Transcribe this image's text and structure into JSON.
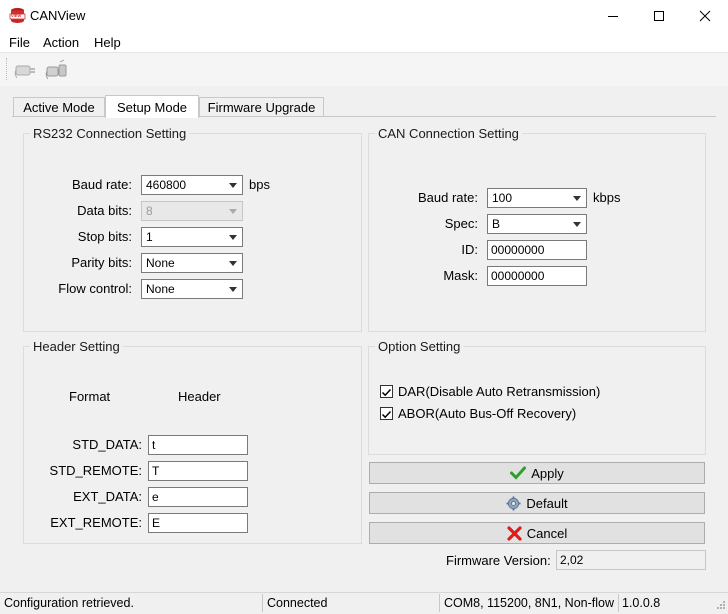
{
  "window": {
    "title": "CANView",
    "icon_text": "VIEW",
    "accent_color": "#d32f2f"
  },
  "menu": {
    "file": "File",
    "action": "Action",
    "help": "Help"
  },
  "toolbar": {
    "connect_icon": "connect-plug-icon",
    "disconnect_icon": "disconnect-plug-icon"
  },
  "tabs": [
    {
      "label": "Active Mode",
      "active": false
    },
    {
      "label": "Setup Mode",
      "active": true
    },
    {
      "label": "Firmware Upgrade",
      "active": false
    }
  ],
  "rs232": {
    "title": "RS232 Connection Setting",
    "baud_label": "Baud rate:",
    "baud_value": "460800",
    "baud_unit": "bps",
    "data_bits_label": "Data bits:",
    "data_bits_value": "8",
    "stop_bits_label": "Stop bits:",
    "stop_bits_value": "1",
    "parity_label": "Parity bits:",
    "parity_value": "None",
    "flow_label": "Flow control:",
    "flow_value": "None"
  },
  "can": {
    "title": "CAN Connection Setting",
    "baud_label": "Baud rate:",
    "baud_value": "100",
    "baud_unit": "kbps",
    "spec_label": "Spec:",
    "spec_value": "B",
    "id_label": "ID:",
    "id_value": "00000000",
    "mask_label": "Mask:",
    "mask_value": "00000000"
  },
  "header": {
    "title": "Header Setting",
    "col_format": "Format",
    "col_header": "Header",
    "std_data_label": "STD_DATA:",
    "std_data_value": "t",
    "std_remote_label": "STD_REMOTE:",
    "std_remote_value": "T",
    "ext_data_label": "EXT_DATA:",
    "ext_data_value": "e",
    "ext_remote_label": "EXT_REMOTE:",
    "ext_remote_value": "E"
  },
  "option": {
    "title": "Option Setting",
    "dar_label": "DAR(Disable Auto Retransmission)",
    "dar_checked": true,
    "abor_label": "ABOR(Auto Bus-Off Recovery)",
    "abor_checked": true
  },
  "buttons": {
    "apply": "Apply",
    "default": "Default",
    "cancel": "Cancel"
  },
  "firmware": {
    "label": "Firmware Version:",
    "value": "2,02"
  },
  "status": {
    "message": "Configuration retrieved.",
    "connection": "Connected",
    "port_settings": "COM8, 115200, 8N1, Non-flow",
    "version": "1.0.0.8"
  }
}
